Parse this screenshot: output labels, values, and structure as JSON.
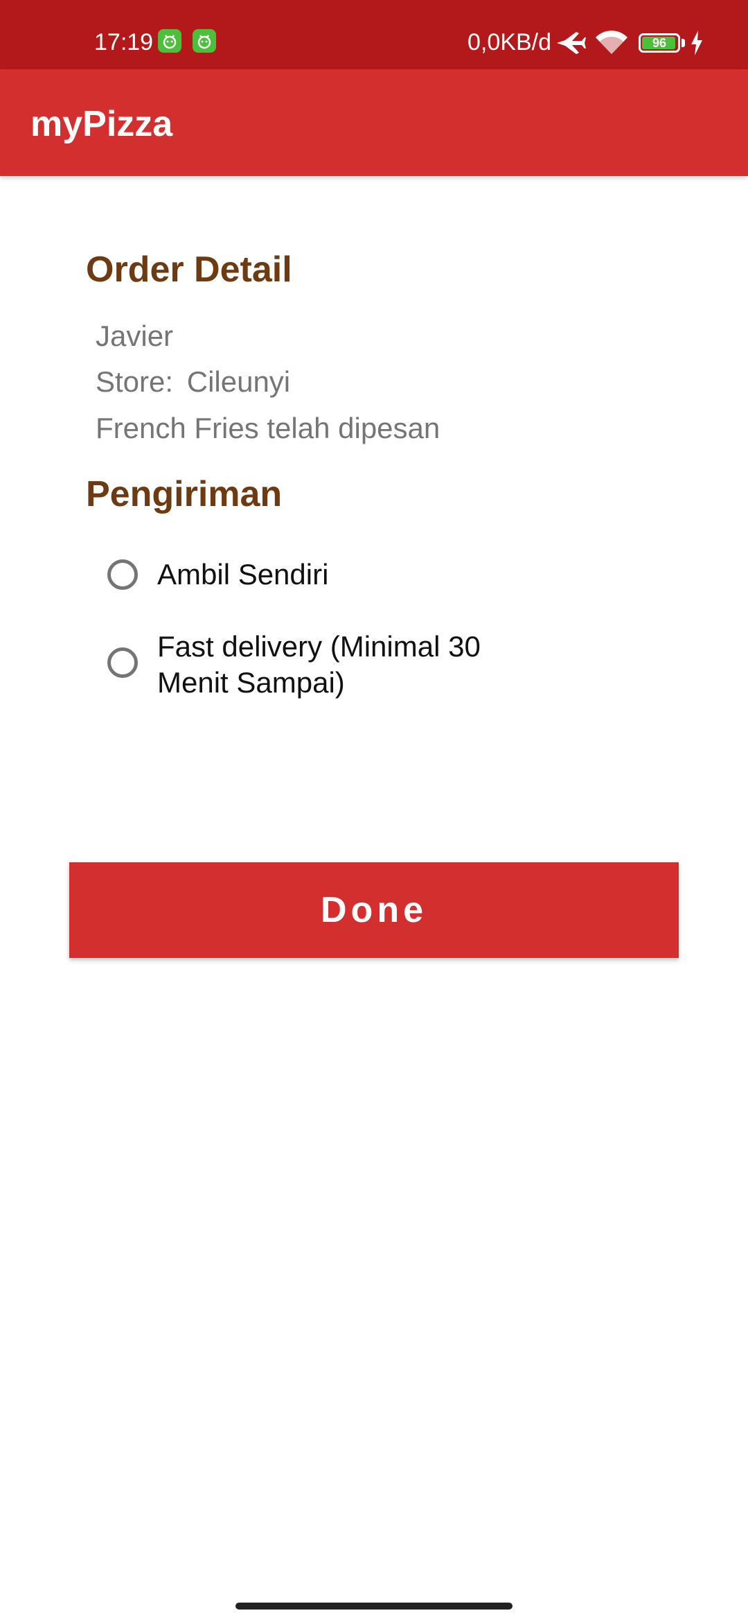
{
  "status_bar": {
    "time": "17:19",
    "net_speed": "0,0KB/d",
    "battery_level": 96,
    "battery_level_text": "96",
    "notification_icons": [
      "android-face-icon",
      "android-face-icon"
    ],
    "status_icons": [
      "airplane-icon",
      "wifi-icon",
      "battery-icon",
      "charging-icon"
    ]
  },
  "app_bar": {
    "title": "myPizza"
  },
  "order_detail": {
    "heading": "Order Detail",
    "customer_name": "Javier",
    "store_label": "Store:",
    "store_name": "Cileunyi",
    "item_status": "French Fries telah dipesan"
  },
  "shipping": {
    "heading": "Pengiriman",
    "options": [
      {
        "label": "Ambil Sendiri",
        "selected": false
      },
      {
        "label": "Fast delivery (Minimal 30 Menit Sampai)",
        "selected": false
      }
    ]
  },
  "done_button": {
    "label": "Done"
  },
  "colors": {
    "status_bar": "#b3191a",
    "app_bar": "#d32f2f",
    "heading": "#6d3a12",
    "secondary_text": "#757575",
    "button": "#d32f2f",
    "battery_fill": "#4cbf3b"
  }
}
